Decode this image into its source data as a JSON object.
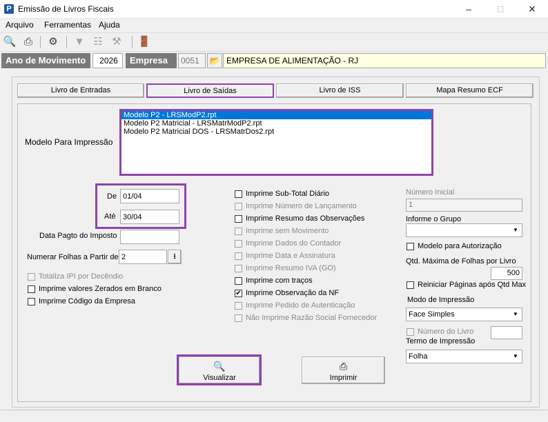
{
  "window": {
    "title": "Emissão de Livros Fiscais",
    "icon_letter": "P"
  },
  "menu": [
    "Arquivo",
    "Ferramentas",
    "Ajuda"
  ],
  "header": {
    "ano_label": "Ano de Movimento",
    "ano_value": "2026",
    "empresa_label": "Empresa",
    "empresa_code": "0051",
    "empresa_name": "EMPRESA DE ALIMENTAÇÃO - RJ"
  },
  "tabs": [
    "Livro de Entradas",
    "Livro de Saídas",
    "Livro de ISS",
    "Mapa Resumo ECF"
  ],
  "modelo": {
    "label": "Modelo Para Impressão",
    "items": [
      "Modelo P2 - LRSModP2.rpt",
      "Modelo P2 Matricial - LRSMatrModP2.rpt",
      "Modelo P2 Matricial DOS - LRSMatrDos2.rpt"
    ]
  },
  "periodo": {
    "de_label": "De",
    "de_value": "01/04",
    "ate_label": "Até",
    "ate_value": "30/04"
  },
  "data_pagto": {
    "label": "Data Pagto do Imposto",
    "value": ""
  },
  "numerar": {
    "label": "Numerar Folhas a Partir de",
    "value": "2"
  },
  "left_checks": [
    {
      "label": "Totaliza IPI por Decêndio",
      "checked": false,
      "disabled": true
    },
    {
      "label": "Imprime valores Zerados em Branco",
      "checked": false,
      "disabled": false
    },
    {
      "label": "Imprime Código da Empresa",
      "checked": false,
      "disabled": false
    }
  ],
  "mid_checks": [
    {
      "label": "Imprime Sub-Total Diário",
      "checked": false,
      "disabled": false
    },
    {
      "label": "Imprime Número de Lançamento",
      "checked": false,
      "disabled": true
    },
    {
      "label": "Imprime Resumo das Observações",
      "checked": false,
      "disabled": false
    },
    {
      "label": "Imprime sem Movimento",
      "checked": false,
      "disabled": true
    },
    {
      "label": "Imprime Dados do Contador",
      "checked": false,
      "disabled": true
    },
    {
      "label": "Imprime Data e Assinatura",
      "checked": false,
      "disabled": true
    },
    {
      "label": "Imprime Resumo IVA (GO)",
      "checked": false,
      "disabled": true
    },
    {
      "label": "Imprime com traços",
      "checked": false,
      "disabled": false
    },
    {
      "label": "Imprime Observação da NF",
      "checked": true,
      "disabled": false
    },
    {
      "label": "Imprime Pedido de Autenticação",
      "checked": false,
      "disabled": true
    },
    {
      "label": "Não Imprime Razão Social Fornecedor",
      "checked": false,
      "disabled": true
    }
  ],
  "right": {
    "numero_inicial_label": "Número Inicial",
    "numero_inicial_value": "1",
    "grupo_label": "Informe o Grupo",
    "grupo_value": "",
    "modelo_autorizacao_label": "Modelo para Autorização",
    "qtd_max_label": "Qtd. Máxima de Folhas por Livro",
    "qtd_max_value": "500",
    "reiniciar_label": "Reiniciar Páginas após Qtd Max",
    "modo_label": "Modo de Impressão",
    "modo_value": "Face Simples",
    "numero_livro_label": "Número do Livro",
    "numero_livro_value": "",
    "termo_label": "Termo de Impressão",
    "termo_value": "Folha"
  },
  "buttons": {
    "visualizar": "Visualizar",
    "imprimir": "Imprimir"
  },
  "colors": {
    "highlight": "#8e44ad",
    "selection": "#0078d7",
    "header_label_bg": "#7a7a7a",
    "company_name_bg": "#ffffe1"
  }
}
